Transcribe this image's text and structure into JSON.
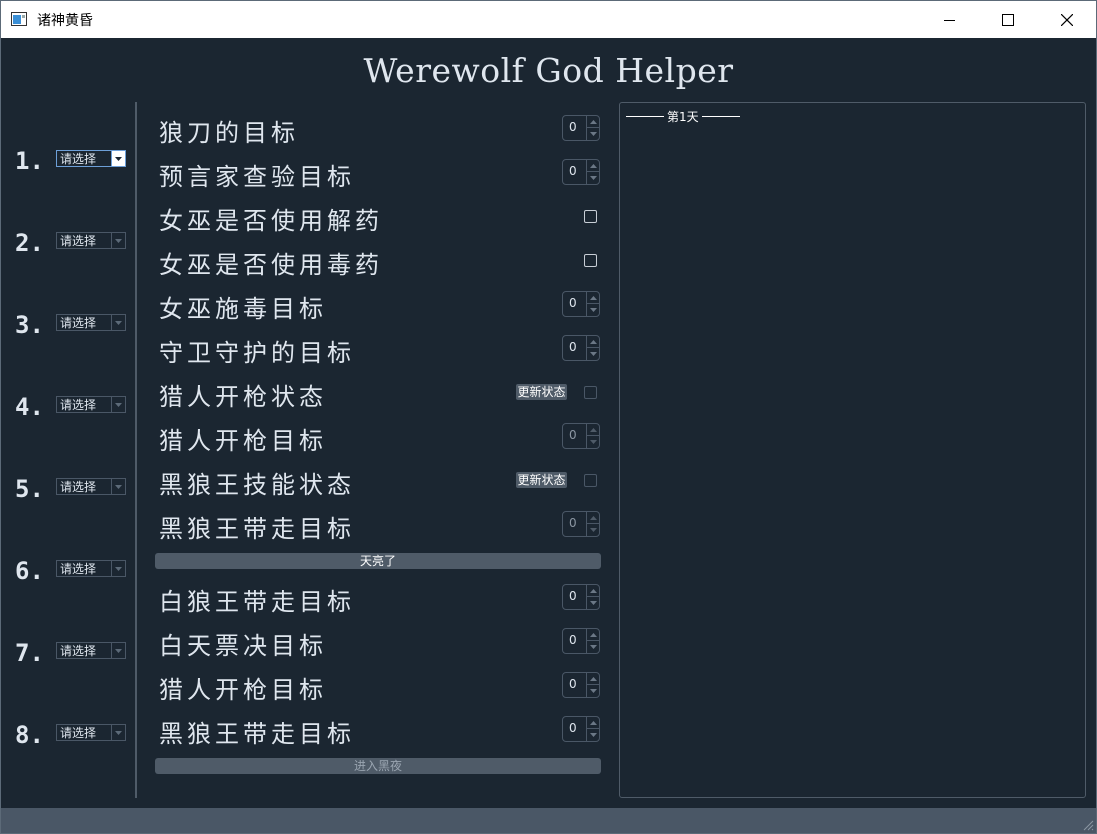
{
  "window": {
    "title": "诸神黄昏",
    "controls": [
      "minimize-icon",
      "maximize-icon",
      "close-icon"
    ]
  },
  "heading": "Werewolf God Helper",
  "players": [
    {
      "number": "1.",
      "select": "请选择"
    },
    {
      "number": "2.",
      "select": "请选择"
    },
    {
      "number": "3.",
      "select": "请选择"
    },
    {
      "number": "4.",
      "select": "请选择"
    },
    {
      "number": "5.",
      "select": "请选择"
    },
    {
      "number": "6.",
      "select": "请选择"
    },
    {
      "number": "7.",
      "select": "请选择"
    },
    {
      "number": "8.",
      "select": "请选择"
    }
  ],
  "night_actions": [
    {
      "label": "狼刀的目标",
      "value": "0"
    },
    {
      "label": "预言家查验目标",
      "value": "0"
    },
    {
      "label": "女巫是否使用解药",
      "checked": false
    },
    {
      "label": "女巫是否使用毒药",
      "checked": false
    },
    {
      "label": "女巫施毒目标",
      "value": "0"
    },
    {
      "label": "守卫守护的目标",
      "value": "0"
    },
    {
      "label": "猎人开枪状态",
      "button": "更新状态",
      "checked": false
    },
    {
      "label": "猎人开枪目标",
      "value": "0"
    },
    {
      "label": "黑狼王技能状态",
      "button": "更新状态",
      "checked": false
    },
    {
      "label": "黑狼王带走目标",
      "value": "0"
    }
  ],
  "dawn_button": "天亮了",
  "day_actions": [
    {
      "label": "白狼王带走目标",
      "value": "0"
    },
    {
      "label": "白天票决目标",
      "value": "0"
    },
    {
      "label": "猎人开枪目标",
      "value": "0"
    },
    {
      "label": "黑狼王带走目标",
      "value": "0"
    }
  ],
  "night_button": "进入黑夜",
  "log": {
    "day_separator": "第1天"
  },
  "colors": {
    "background": "#1b2631",
    "panel_border": "#4f5b68",
    "button": "#4f5b68",
    "text": "#dfe6ee",
    "focus": "#6d9fd8"
  }
}
